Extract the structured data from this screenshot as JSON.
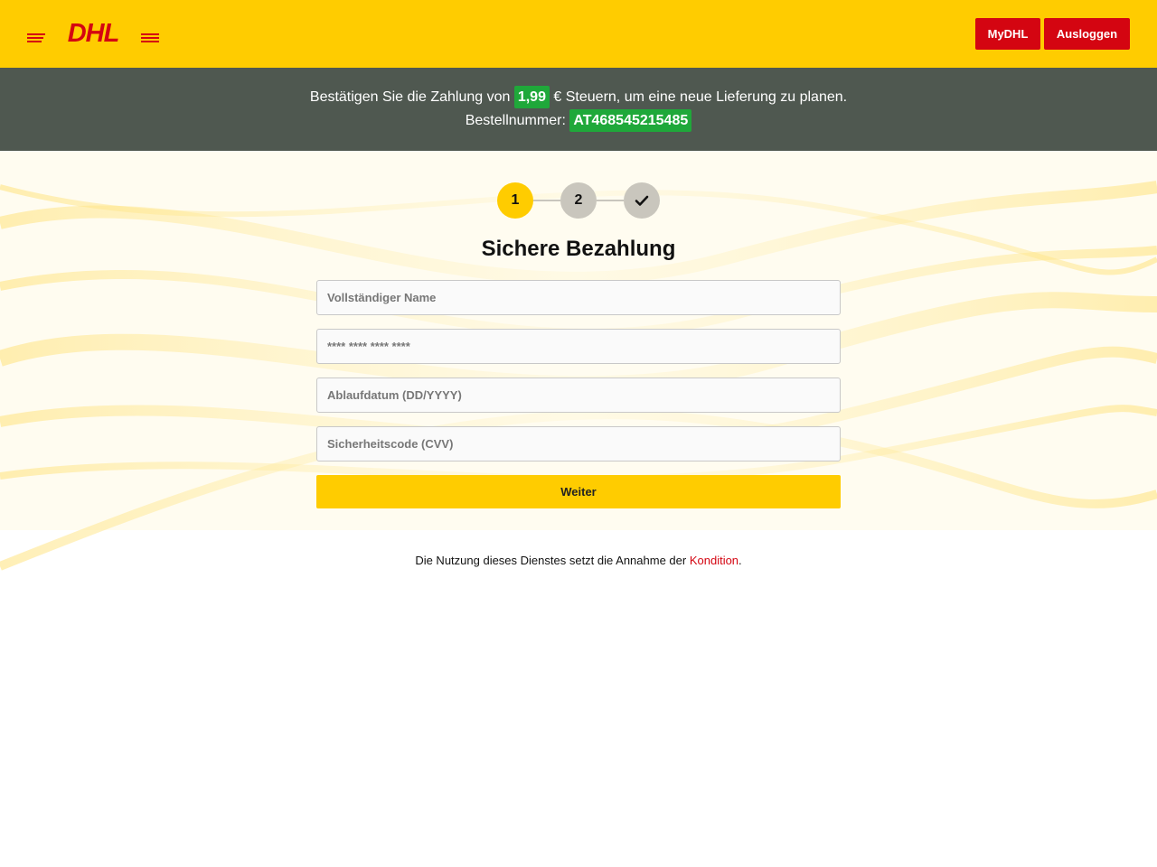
{
  "header": {
    "logo_text": "DHL",
    "mydhl_label": "MyDHL",
    "logout_label": "Ausloggen"
  },
  "notice": {
    "line1_before": "Bestätigen Sie die Zahlung von ",
    "amount": "1,99",
    "line1_after": " € Steuern, um eine neue Lieferung zu planen.",
    "order_label": "Bestellnummer: ",
    "order_number": "AT468545215485"
  },
  "steps": {
    "step1": "1",
    "step2": "2",
    "step3_icon": "check-icon",
    "active_step": 1
  },
  "form": {
    "title": "Sichere Bezahlung",
    "name_placeholder": "Vollständiger Name",
    "card_placeholder": "**** **** **** ****",
    "expiry_placeholder": "Ablaufdatum (DD/YYYY)",
    "cvv_placeholder": "Sicherheitscode (CVV)",
    "submit_label": "Weiter"
  },
  "footer": {
    "text_before": "Die Nutzung dieses Dienstes setzt die Annahme der ",
    "link_text": "Kondition",
    "text_after": "."
  },
  "colors": {
    "brand_yellow": "#ffcc00",
    "brand_red": "#d40511",
    "notice_bg": "#4f5850",
    "highlight_green": "#1fa83a",
    "step_inactive": "#c9c6bd"
  }
}
